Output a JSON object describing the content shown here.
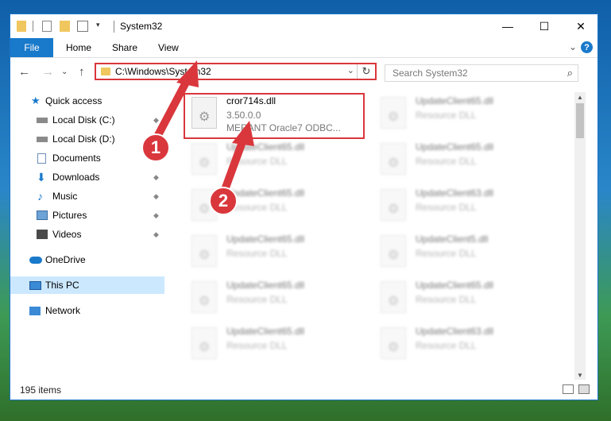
{
  "window": {
    "title": "System32",
    "controls": {
      "minimize": "—",
      "maximize": "☐",
      "close": "✕"
    }
  },
  "ribbon": {
    "tabs": [
      "File",
      "Home",
      "Share",
      "View"
    ],
    "expand_glyph": "⌄",
    "help_glyph": "?"
  },
  "address_bar": {
    "path": "C:\\Windows\\System32",
    "dropdown_glyph": "⌄",
    "refresh_glyph": "↻"
  },
  "search": {
    "placeholder": "Search System32",
    "icon": "⌕"
  },
  "navigation": {
    "back": "←",
    "forward": "→",
    "recent": "⌄",
    "up": "↑"
  },
  "sidebar": {
    "items": [
      {
        "label": "Quick access",
        "icon": "star-icon",
        "pinned": false
      },
      {
        "label": "Local Disk (C:)",
        "icon": "drive-icon",
        "pinned": true
      },
      {
        "label": "Local Disk (D:)",
        "icon": "drive-icon",
        "pinned": true
      },
      {
        "label": "Documents",
        "icon": "document-icon",
        "pinned": true
      },
      {
        "label": "Downloads",
        "icon": "download-icon",
        "pinned": true
      },
      {
        "label": "Music",
        "icon": "music-icon",
        "pinned": true
      },
      {
        "label": "Pictures",
        "icon": "pictures-icon",
        "pinned": true
      },
      {
        "label": "Videos",
        "icon": "videos-icon",
        "pinned": true
      },
      {
        "label": "OneDrive",
        "icon": "cloud-icon",
        "pinned": false
      },
      {
        "label": "This PC",
        "icon": "computer-icon",
        "pinned": false,
        "selected": true
      },
      {
        "label": "Network",
        "icon": "network-icon",
        "pinned": false
      }
    ],
    "pin_glyph": "📌"
  },
  "files": {
    "highlighted": {
      "name": "cror714s.dll",
      "version": "3.50.0.0",
      "description": "MERANT Oracle7 ODBC..."
    },
    "left_column": [
      {
        "name": "UpdateClient65.dll",
        "type": "Resource DLL"
      },
      {
        "name": "UpdateClient65.dll",
        "type": "Resource DLL"
      },
      {
        "name": "UpdateClient65.dll",
        "type": "Resource DLL"
      },
      {
        "name": "UpdateClient65.dll",
        "type": "Resource DLL"
      },
      {
        "name": "UpdateClient65.dll",
        "type": "Resource DLL"
      }
    ],
    "right_column": [
      {
        "name": "UpdateClient65.dll",
        "type": "Resource DLL"
      },
      {
        "name": "UpdateClient65.dll",
        "type": "Resource DLL"
      },
      {
        "name": "UpdateClient63.dll",
        "type": "Resource DLL"
      },
      {
        "name": "UpdateClient5.dll",
        "type": "Resource DLL"
      },
      {
        "name": "UpdateClient65.dll",
        "type": "Resource DLL"
      },
      {
        "name": "UpdateClient63.dll",
        "type": "Resource DLL"
      }
    ],
    "gear_glyph": "⚙"
  },
  "status": {
    "item_count": "195 items"
  },
  "annotations": {
    "step1": "1",
    "step2": "2"
  },
  "colors": {
    "accent": "#1979ca",
    "highlight": "#d9373c",
    "selected_bg": "#cce8ff"
  }
}
